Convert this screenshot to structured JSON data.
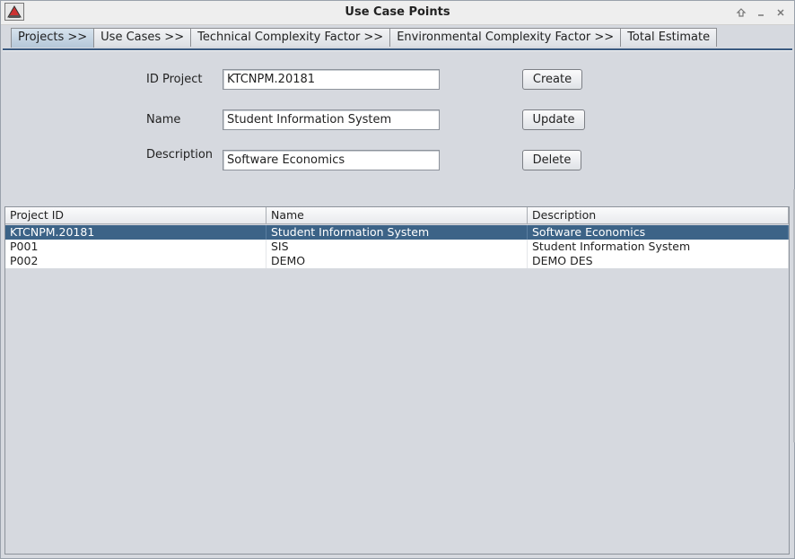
{
  "window": {
    "title": "Use Case Points"
  },
  "tabs": [
    {
      "label": "Projects >>",
      "active": true
    },
    {
      "label": "Use Cases >>",
      "active": false
    },
    {
      "label": "Technical Complexity Factor >>",
      "active": false
    },
    {
      "label": "Environmental Complexity Factor >>",
      "active": false
    },
    {
      "label": "Total Estimate",
      "active": false
    }
  ],
  "form": {
    "id_label": "ID Project",
    "id_value": "KTCNPM.20181",
    "name_label": "Name",
    "name_value": "Student Information System",
    "description_label": "Description",
    "description_value": "Software Economics"
  },
  "buttons": {
    "create": "Create",
    "update": "Update",
    "delete": "Delete"
  },
  "table": {
    "columns": [
      "Project ID",
      "Name",
      "Description"
    ],
    "rows": [
      {
        "id": "KTCNPM.20181",
        "name": "Student Information System",
        "description": "Software Economics",
        "selected": true
      },
      {
        "id": "P001",
        "name": "SIS",
        "description": "Student Information System",
        "selected": false
      },
      {
        "id": "P002",
        "name": "DEMO",
        "description": "DEMO DES",
        "selected": false
      }
    ]
  },
  "colors": {
    "selection": "#3c6387",
    "tab_active": "#b5c7d9",
    "background": "#d6d9df"
  }
}
